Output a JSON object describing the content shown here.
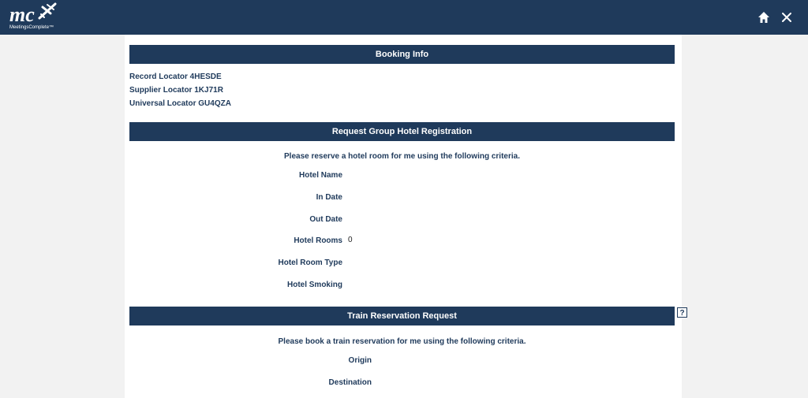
{
  "header": {
    "logo_text": "mc",
    "logo_subtext": "MeetingsComplete™",
    "home_icon": "home-icon",
    "close_icon": "close-icon"
  },
  "booking_info": {
    "title": "Booking Info",
    "record_locator": "Record Locator 4HESDE",
    "supplier_locator": "Supplier Locator 1KJ71R",
    "universal_locator": "Universal Locator GU4QZA"
  },
  "hotel": {
    "title": "Request Group Hotel Registration",
    "intro": "Please reserve a hotel room for me using the following criteria.",
    "fields": [
      {
        "label": "Hotel Name",
        "value": ""
      },
      {
        "label": "In Date",
        "value": ""
      },
      {
        "label": "Out Date",
        "value": ""
      },
      {
        "label": "Hotel Rooms",
        "value": "0"
      },
      {
        "label": "Hotel Room Type",
        "value": ""
      },
      {
        "label": "Hotel Smoking",
        "value": ""
      }
    ]
  },
  "train": {
    "title": "Train Reservation Request",
    "help_label": "?",
    "intro": "Please book a train reservation for me using the following criteria.",
    "fields": [
      {
        "label": "Origin",
        "value": ""
      },
      {
        "label": "Destination",
        "value": ""
      }
    ]
  },
  "colors": {
    "navy": "#1f3a5b",
    "page_bg": "#f2f2f2",
    "content_bg": "#ffffff"
  }
}
